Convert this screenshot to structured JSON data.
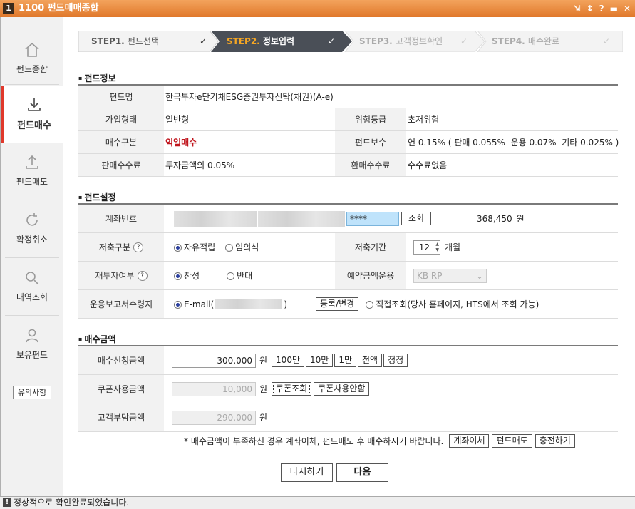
{
  "window": {
    "number": "1",
    "title": "1100 펀드매매종합",
    "icons": [
      "⇲",
      "↕",
      "?",
      "▬",
      "✕"
    ]
  },
  "sidebar": {
    "items": [
      {
        "label": "펀드종합"
      },
      {
        "label": "펀드매수"
      },
      {
        "label": "펀드매도"
      },
      {
        "label": "확정취소"
      },
      {
        "label": "내역조회"
      },
      {
        "label": "보유펀드"
      }
    ],
    "notice": "유의사항"
  },
  "steps": [
    {
      "num": "STEP1.",
      "label": "펀드선택",
      "check": "✓"
    },
    {
      "num": "STEP2.",
      "label": "정보입력",
      "check": "✓"
    },
    {
      "num": "STEP3.",
      "label": "고객정보확인",
      "check": "✓"
    },
    {
      "num": "STEP4.",
      "label": "매수완료",
      "check": "✓"
    }
  ],
  "fund_info": {
    "title": "펀드정보",
    "fund_name_label": "펀드명",
    "fund_name": "한국투자e단기채ESG증권투자신탁(채권)(A-e)",
    "join_type_label": "가입형태",
    "join_type": "일반형",
    "risk_label": "위험등급",
    "risk": "초저위험",
    "buy_type_label": "매수구분",
    "buy_type": "익일매수",
    "fee_label": "펀드보수",
    "fee": "연 0.15% ( 판매 0.055%  운용 0.07%  기타 0.025% )",
    "sales_fee_label": "판매수수료",
    "sales_fee": "투자금액의 0.05%",
    "redeem_fee_label": "환매수수료",
    "redeem_fee": "수수료없음"
  },
  "fund_setting": {
    "title": "펀드설정",
    "account_label": "계좌번호",
    "password": "****",
    "lookup_button": "조회",
    "balance": "368,450",
    "balance_unit": "원",
    "saving_type_label": "저축구분",
    "saving_type_options": [
      "자유적립",
      "임의식"
    ],
    "saving_period_label": "저축기간",
    "saving_period": "12",
    "saving_period_unit": "개월",
    "reinvest_label": "재투자여부",
    "reinvest_options": [
      "찬성",
      "반대"
    ],
    "deposit_label": "예약금액운용",
    "deposit_value": "KB RP",
    "report_label": "운용보고서수령지",
    "report_email": "E-mail(",
    "report_email_end": ")",
    "register_button": "등록/변경",
    "report_direct": "직접조회(당사 홈페이지, HTS에서 조회 가능)"
  },
  "amount": {
    "title": "매수금액",
    "request_label": "매수신청금액",
    "request_value": "300,000",
    "unit": "원",
    "quick_buttons": [
      "100만",
      "10만",
      "1만",
      "전액",
      "정정"
    ],
    "coupon_label": "쿠폰사용금액",
    "coupon_value": "10,000",
    "coupon_lookup": "쿠폰조회",
    "coupon_none": "쿠폰사용안함",
    "customer_label": "고객부담금액",
    "customer_value": "290,000",
    "note": "* 매수금액이 부족하신 경우 계좌이체, 펀드매도 후 매수하시기 바랍니다.",
    "action_buttons": [
      "계좌이체",
      "펀드매도",
      "충전하기"
    ]
  },
  "footer": {
    "reset": "다시하기",
    "next": "다음"
  },
  "status": {
    "icon": "!",
    "message": "정상적으로 확인완료되었습니다."
  },
  "colors": {
    "title_bar": "#e0782b",
    "active_step": "#4a4f57",
    "active_step_text": "#f5a623",
    "highlight_red": "#c0161e",
    "active_nav": "#e0382b"
  }
}
